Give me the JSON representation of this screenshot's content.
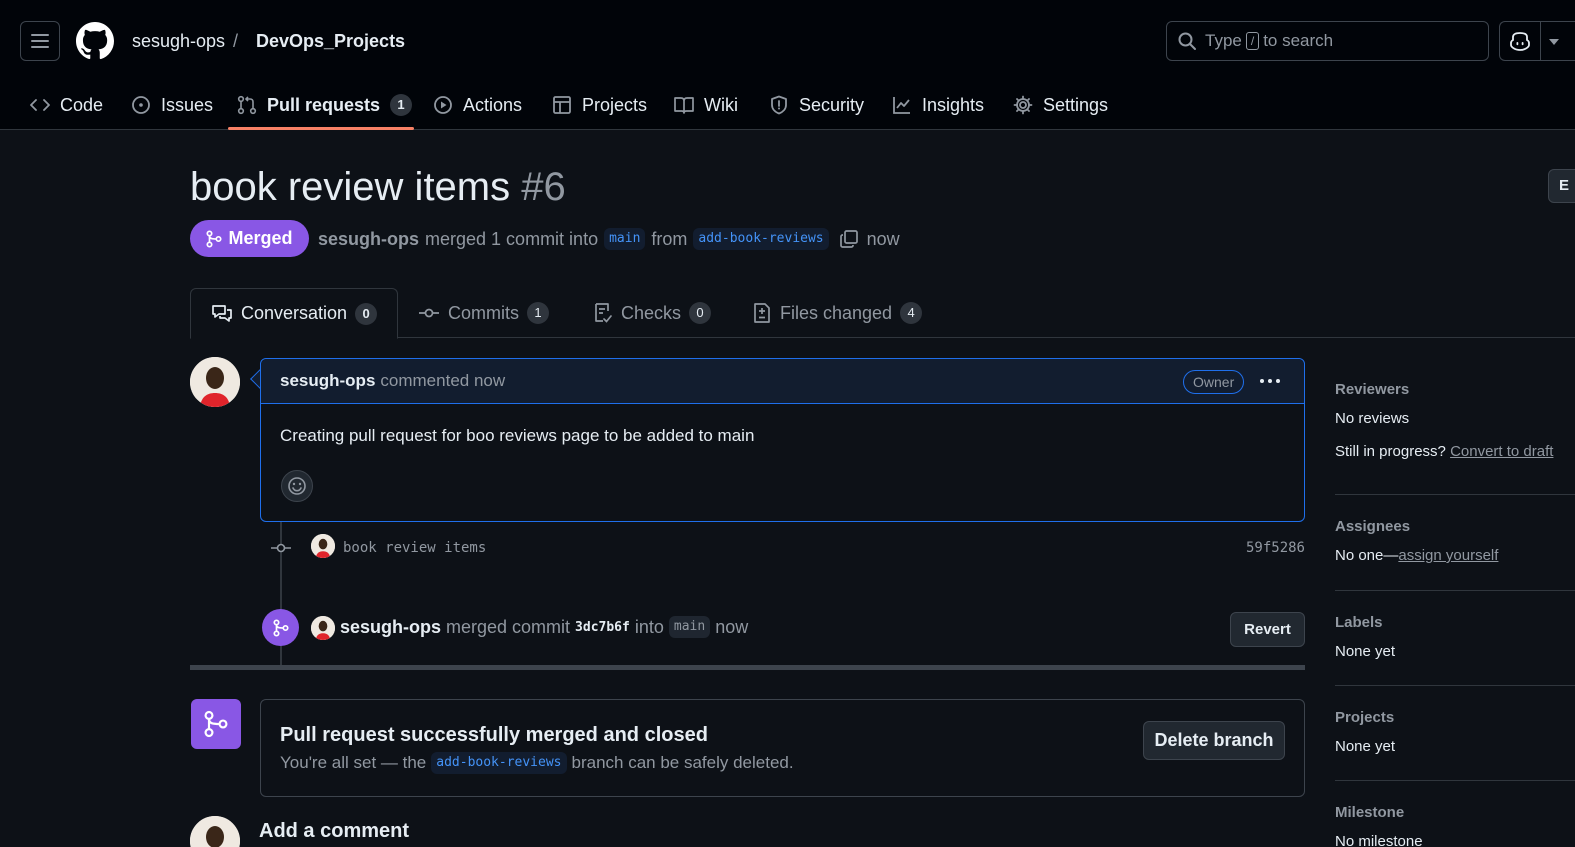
{
  "header": {
    "owner": "sesugh-ops",
    "separator": "/",
    "repo": "DevOps_Projects",
    "search_prefix": "Type",
    "search_key": "/",
    "search_suffix": "to search"
  },
  "nav": {
    "code": "Code",
    "issues": "Issues",
    "pull_requests": "Pull requests",
    "pull_requests_count": "1",
    "actions": "Actions",
    "projects": "Projects",
    "wiki": "Wiki",
    "security": "Security",
    "insights": "Insights",
    "settings": "Settings"
  },
  "pr": {
    "title": "book review items",
    "number": "#6",
    "edit_label": "E",
    "state": "Merged",
    "author": "sesugh-ops",
    "merged_text": "merged 1 commit into",
    "base": "main",
    "from_text": "from",
    "head": "add-book-reviews",
    "time": "now"
  },
  "tabs": {
    "conversation": "Conversation",
    "conversation_count": "0",
    "commits": "Commits",
    "commits_count": "1",
    "checks": "Checks",
    "checks_count": "0",
    "files": "Files changed",
    "files_count": "4"
  },
  "comment": {
    "author": "sesugh-ops",
    "action": "commented now",
    "badge": "Owner",
    "body": "Creating pull request for boo reviews page to be added to main"
  },
  "commit": {
    "message": "book review items",
    "sha": "59f5286"
  },
  "merge_event": {
    "author": "sesugh-ops",
    "text1": "merged commit",
    "sha": "3dc7b6f",
    "text2": "into",
    "base": "main",
    "time": "now",
    "revert": "Revert"
  },
  "merged_box": {
    "title": "Pull request successfully merged and closed",
    "sub1": "You're all set — the",
    "branch": "add-book-reviews",
    "sub2": "branch can be safely deleted.",
    "delete_label": "Delete branch"
  },
  "add_comment": "Add a comment",
  "sidebar": {
    "reviewers_head": "Reviewers",
    "reviewers_value": "No reviews",
    "progress_text": "Still in progress?",
    "convert_link": "Convert to draft",
    "assignees_head": "Assignees",
    "assignees_value": "No one—",
    "assign_link": "assign yourself",
    "labels_head": "Labels",
    "labels_value": "None yet",
    "projects_head": "Projects",
    "projects_value": "None yet",
    "milestone_head": "Milestone",
    "milestone_value": "No milestone"
  },
  "colors": {
    "merged": "#8957e5",
    "accent_blue": "#4493f8",
    "nav_underline": "#f78166"
  }
}
